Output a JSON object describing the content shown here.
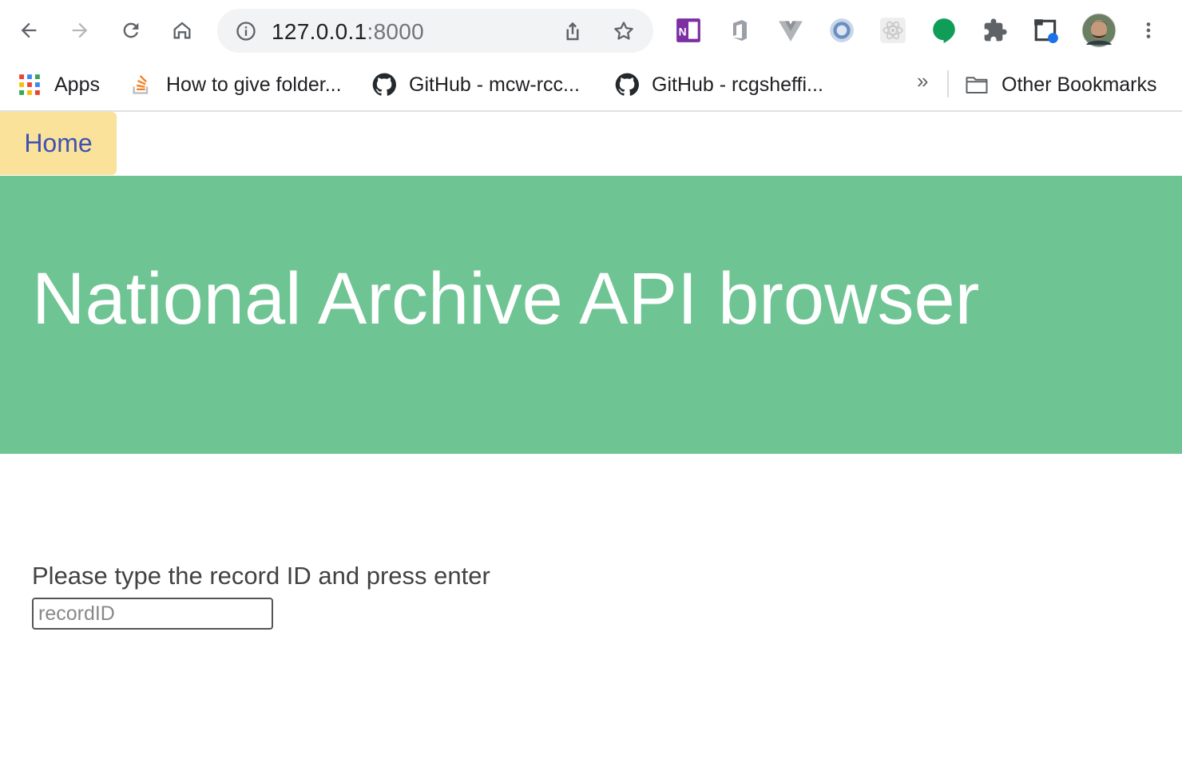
{
  "browser": {
    "url_host": "127.0.0.1",
    "url_port": ":8000",
    "extensions": [
      "onenote-icon",
      "office-icon",
      "vue-devtools-icon",
      "jsonview-icon",
      "react-devtools-icon",
      "hangouts-icon",
      "extensions-puzzle-icon",
      "tab-capture-icon",
      "profile-avatar"
    ]
  },
  "bookmarks": {
    "items": [
      {
        "label": "Apps",
        "icon": "apps-grid-icon"
      },
      {
        "label": "How to give folder...",
        "icon": "stackoverflow-icon"
      },
      {
        "label": "GitHub - mcw-rcc...",
        "icon": "github-icon"
      },
      {
        "label": "GitHub - rcgsheffi...",
        "icon": "github-icon"
      }
    ],
    "overflow": "»",
    "other_label": "Other Bookmarks"
  },
  "page": {
    "nav_home": "Home",
    "hero_title": "National Archive API browser",
    "prompt": "Please type the record ID and press enter",
    "input_placeholder": "recordID",
    "input_value": ""
  },
  "colors": {
    "hero_bg": "#6fc493",
    "home_tab_bg": "#fae29b",
    "home_tab_text": "#3f51b5"
  }
}
